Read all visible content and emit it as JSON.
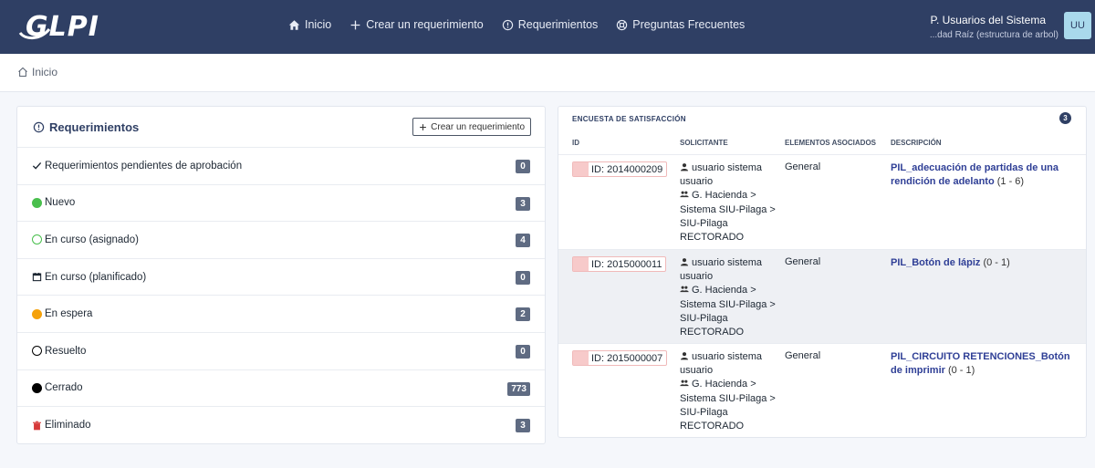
{
  "app": {
    "logo_text": "GLPI"
  },
  "nav": [
    {
      "label": "Inicio",
      "icon": "home-icon"
    },
    {
      "label": "Crear un requerimiento",
      "icon": "plus-icon"
    },
    {
      "label": "Requerimientos",
      "icon": "alert-circle-icon"
    },
    {
      "label": "Preguntas Frecuentes",
      "icon": "lifebuoy-icon"
    }
  ],
  "user": {
    "name": "P. Usuarios del Sistema",
    "entity": "...dad Raíz (estructura de arbol)",
    "initials": "UU"
  },
  "breadcrumb": {
    "home_label": "Inicio"
  },
  "tickets_card": {
    "title": "Requerimientos",
    "create_button": "Crear un requerimiento",
    "rows": [
      {
        "label": "Requerimientos pendientes de aprobación",
        "count": "0",
        "icon": "check-icon"
      },
      {
        "label": "Nuevo",
        "count": "3",
        "icon": "dot-green-icon",
        "color": "#49bf4d"
      },
      {
        "label": "En curso (asignado)",
        "count": "4",
        "icon": "circle-outline-green-icon",
        "color": "#49bf4d"
      },
      {
        "label": "En curso (planificado)",
        "count": "0",
        "icon": "calendar-icon"
      },
      {
        "label": "En espera",
        "count": "2",
        "icon": "dot-orange-icon",
        "color": "#f5a10a"
      },
      {
        "label": "Resuelto",
        "count": "0",
        "icon": "circle-outline-black-icon",
        "color": "#000000"
      },
      {
        "label": "Cerrado",
        "count": "773",
        "icon": "dot-black-icon",
        "color": "#000000"
      },
      {
        "label": "Eliminado",
        "count": "3",
        "icon": "trash-icon",
        "color": "#d63939"
      }
    ]
  },
  "survey_card": {
    "title": "ENCUESTA DE SATISFACCIÓN",
    "count": "3",
    "columns": [
      "ID",
      "SOLICITANTE",
      "ELEMENTOS ASOCIADOS",
      "DESCRIPCIÓN"
    ],
    "rows": [
      {
        "id": "ID: 2014000209",
        "requester_user": "usuario sistema usuario",
        "requester_group": "G. Hacienda > Sistema SIU-Pilaga > SIU-Pilaga RECTORADO",
        "element": "General",
        "desc_link": "PIL_adecuación de partidas de una rendición de adelanto",
        "desc_range": "(1 - 6)"
      },
      {
        "id": "ID: 2015000011",
        "requester_user": "usuario sistema usuario",
        "requester_group": "G. Hacienda > Sistema SIU-Pilaga > SIU-Pilaga RECTORADO",
        "element": "General",
        "desc_link": "PIL_Botón de lápiz",
        "desc_range": "(0 - 1)"
      },
      {
        "id": "ID: 2015000007",
        "requester_user": "usuario sistema usuario",
        "requester_group": "G. Hacienda > Sistema SIU-Pilaga > SIU-Pilaga RECTORADO",
        "element": "General",
        "desc_link": "PIL_CIRCUITO RETENCIONES_Botón de imprimir",
        "desc_range": "(0 - 1)"
      }
    ]
  },
  "colors": {
    "navbar": "#2f3f64",
    "badge": "#5f6b82",
    "link": "#2f3f96"
  }
}
